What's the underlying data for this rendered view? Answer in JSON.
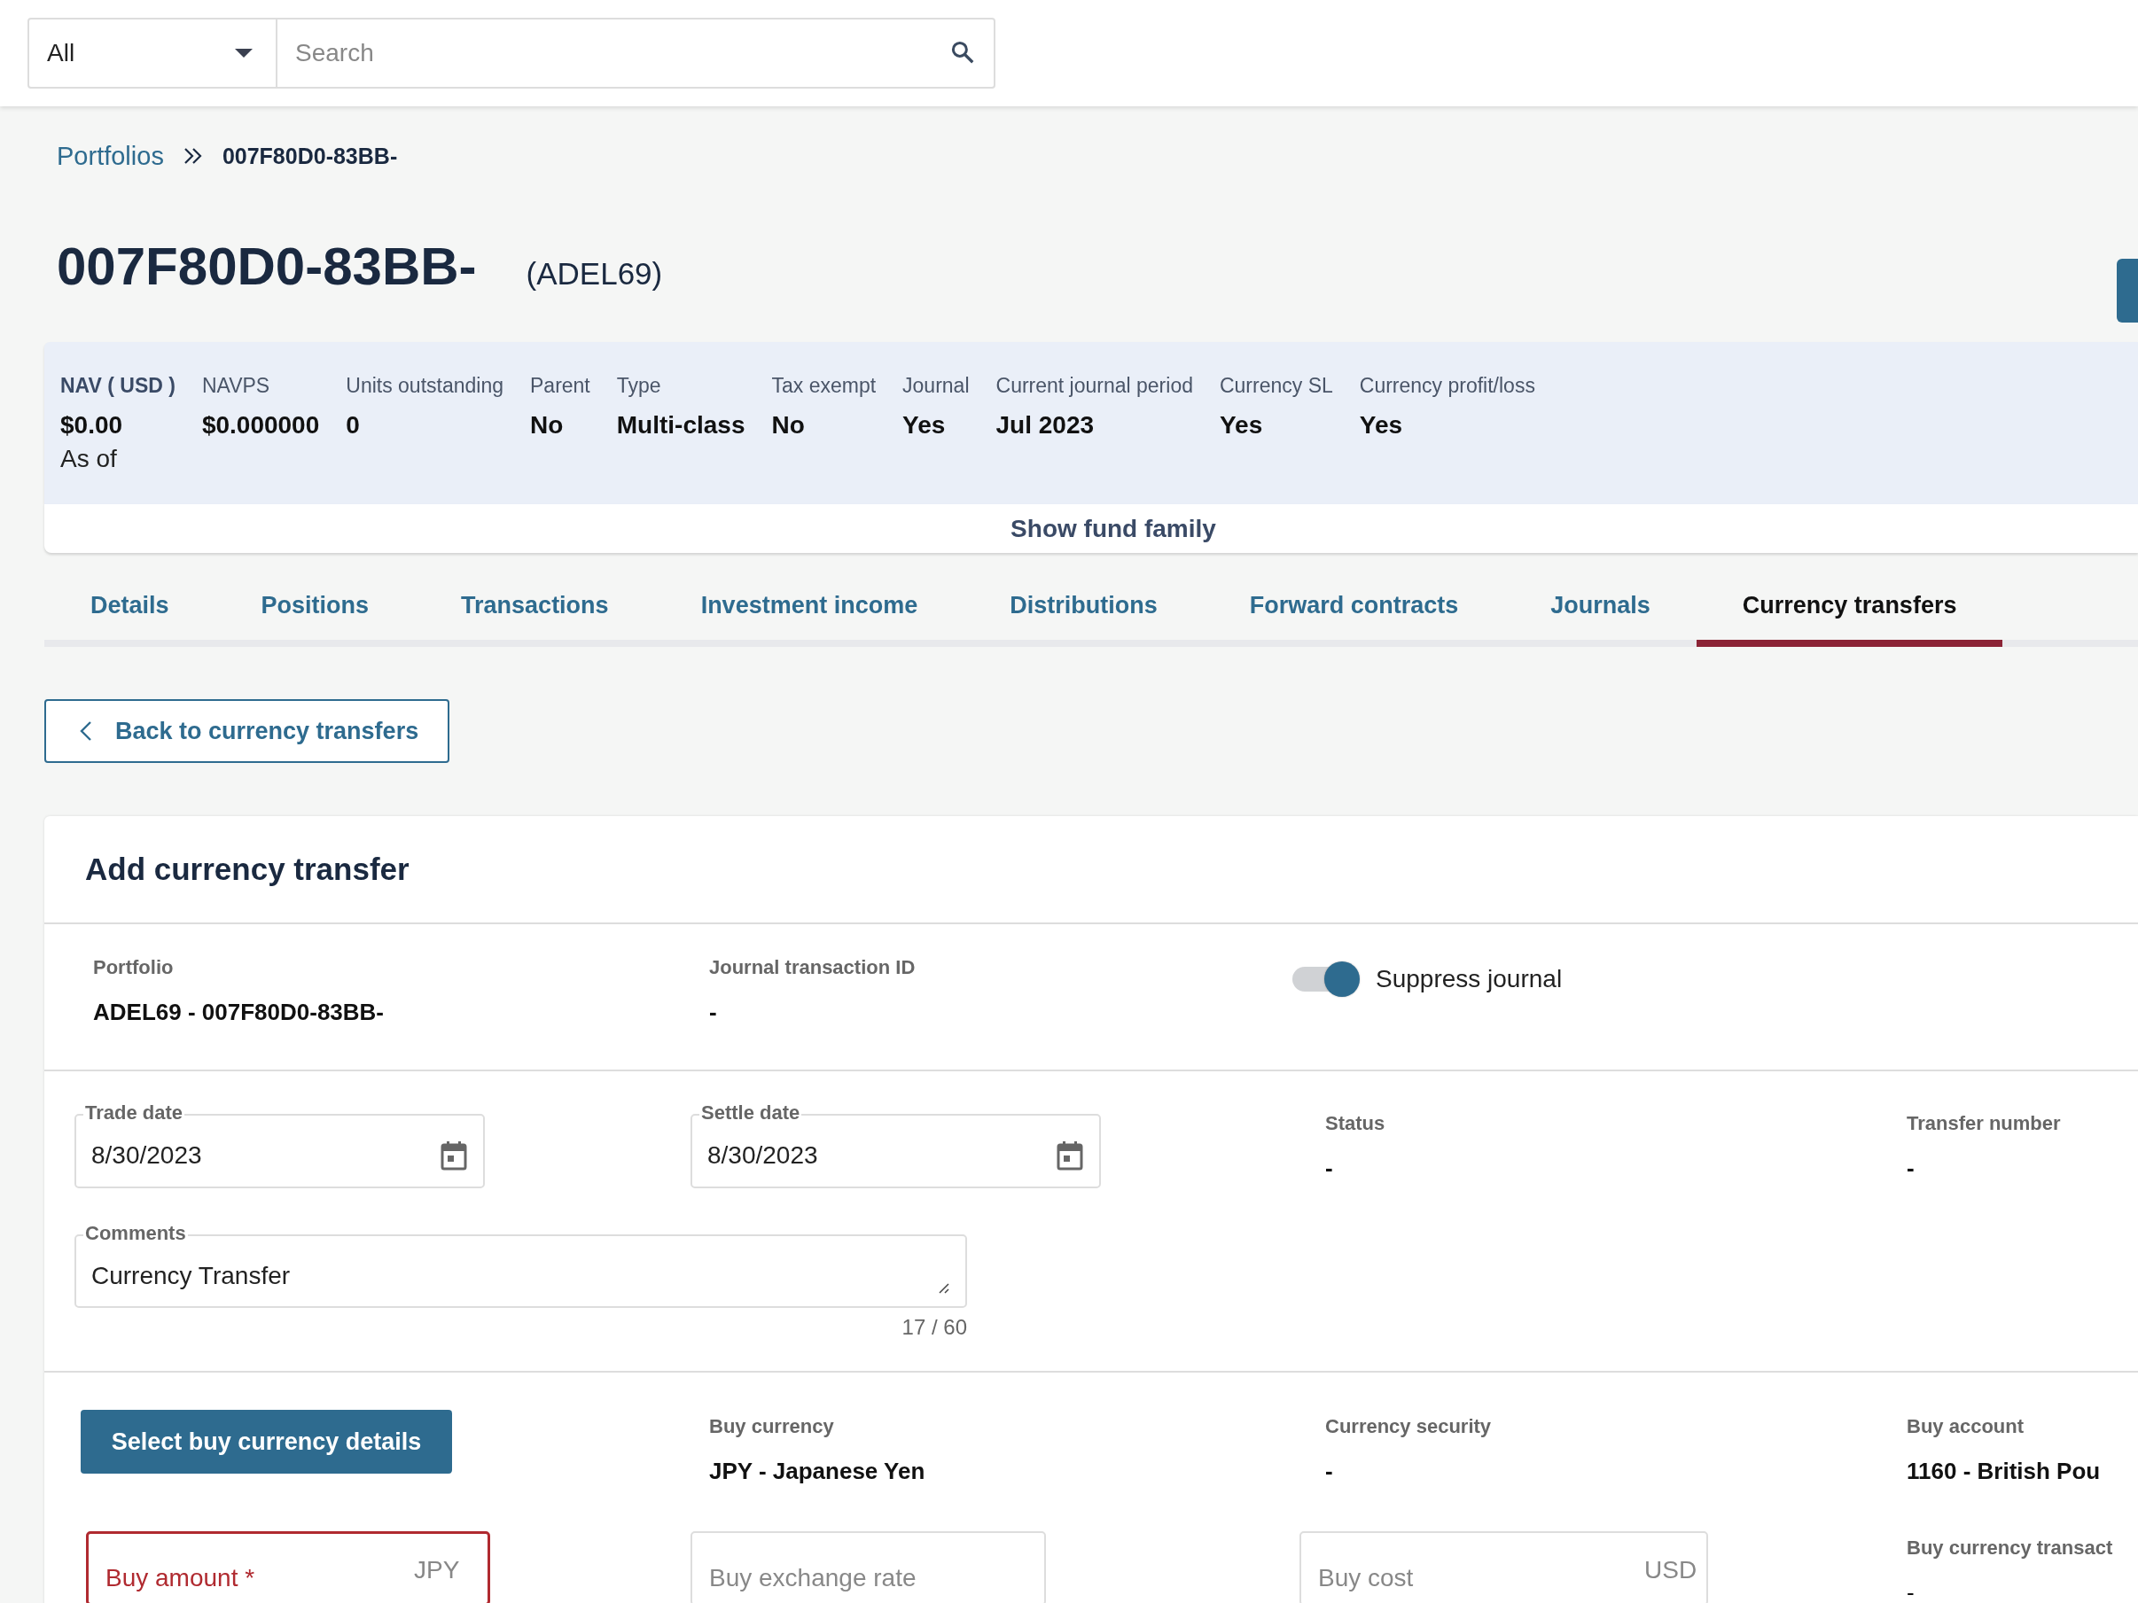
{
  "search_bar": {
    "scope": "All",
    "placeholder": "Search"
  },
  "breadcrumb": [
    {
      "label": "Portfolios",
      "link": true
    },
    {
      "label": "007F80D0-83BB-",
      "link": false
    }
  ],
  "header": {
    "title": "007F80D0-83BB-",
    "code": "(ADEL69)"
  },
  "summary": [
    {
      "label": "NAV ( USD )",
      "value": "$0.00",
      "note": "As of",
      "emphasis": true
    },
    {
      "label": "NAVPS",
      "value": "$0.000000",
      "emphasis": false
    },
    {
      "label": "Units outstanding",
      "value": "0",
      "emphasis": false
    },
    {
      "label": "Parent",
      "value": "No",
      "emphasis": false
    },
    {
      "label": "Type",
      "value": "Multi-class",
      "emphasis": false
    },
    {
      "label": "Tax exempt",
      "value": "No",
      "emphasis": false
    },
    {
      "label": "Journal",
      "value": "Yes",
      "emphasis": false
    },
    {
      "label": "Current journal period",
      "value": "Jul 2023",
      "emphasis": false
    },
    {
      "label": "Currency SL",
      "value": "Yes",
      "emphasis": false
    },
    {
      "label": "Currency profit/loss",
      "value": "Yes",
      "emphasis": false
    }
  ],
  "fund_family_toggle": "Show fund family",
  "tabs": [
    {
      "label": "Details",
      "selected": false
    },
    {
      "label": "Positions",
      "selected": false
    },
    {
      "label": "Transactions",
      "selected": false
    },
    {
      "label": "Investment income",
      "selected": false
    },
    {
      "label": "Distributions",
      "selected": false
    },
    {
      "label": "Forward contracts",
      "selected": false
    },
    {
      "label": "Journals",
      "selected": false
    },
    {
      "label": "Currency transfers",
      "selected": true
    }
  ],
  "back_button": "Back to currency transfers",
  "form": {
    "title": "Add currency transfer",
    "info": [
      {
        "label": "Portfolio",
        "value": "ADEL69 - 007F80D0-83BB-"
      },
      {
        "label": "Journal transaction ID",
        "value": "-"
      }
    ],
    "suppress_journal": {
      "label": "Suppress journal",
      "on": true
    },
    "dates": [
      {
        "label": "Trade date",
        "value": "8/30/2023"
      },
      {
        "label": "Settle date",
        "value": "8/30/2023"
      }
    ],
    "status": {
      "label": "Status",
      "value": "-"
    },
    "transfer_number": {
      "label": "Transfer number",
      "value": "-"
    },
    "comments": {
      "label": "Comments",
      "value": "Currency Transfer",
      "counter": "17 / 60"
    },
    "buy_button": "Select buy currency details",
    "buy_info": [
      {
        "label": "Buy currency",
        "value": "JPY - Japanese Yen"
      },
      {
        "label": "Currency security",
        "value": "-"
      },
      {
        "label": "Buy account",
        "value": "1160 - British Pou"
      }
    ],
    "buy_fields": [
      {
        "placeholder": "Buy amount *",
        "suffix": "JPY",
        "error": true
      },
      {
        "placeholder": "Buy exchange rate",
        "error": false
      },
      {
        "placeholder": "Buy cost",
        "suffix": "USD",
        "error": false
      }
    ],
    "buy_transaction": {
      "label": "Buy currency transact",
      "value": "-"
    }
  }
}
